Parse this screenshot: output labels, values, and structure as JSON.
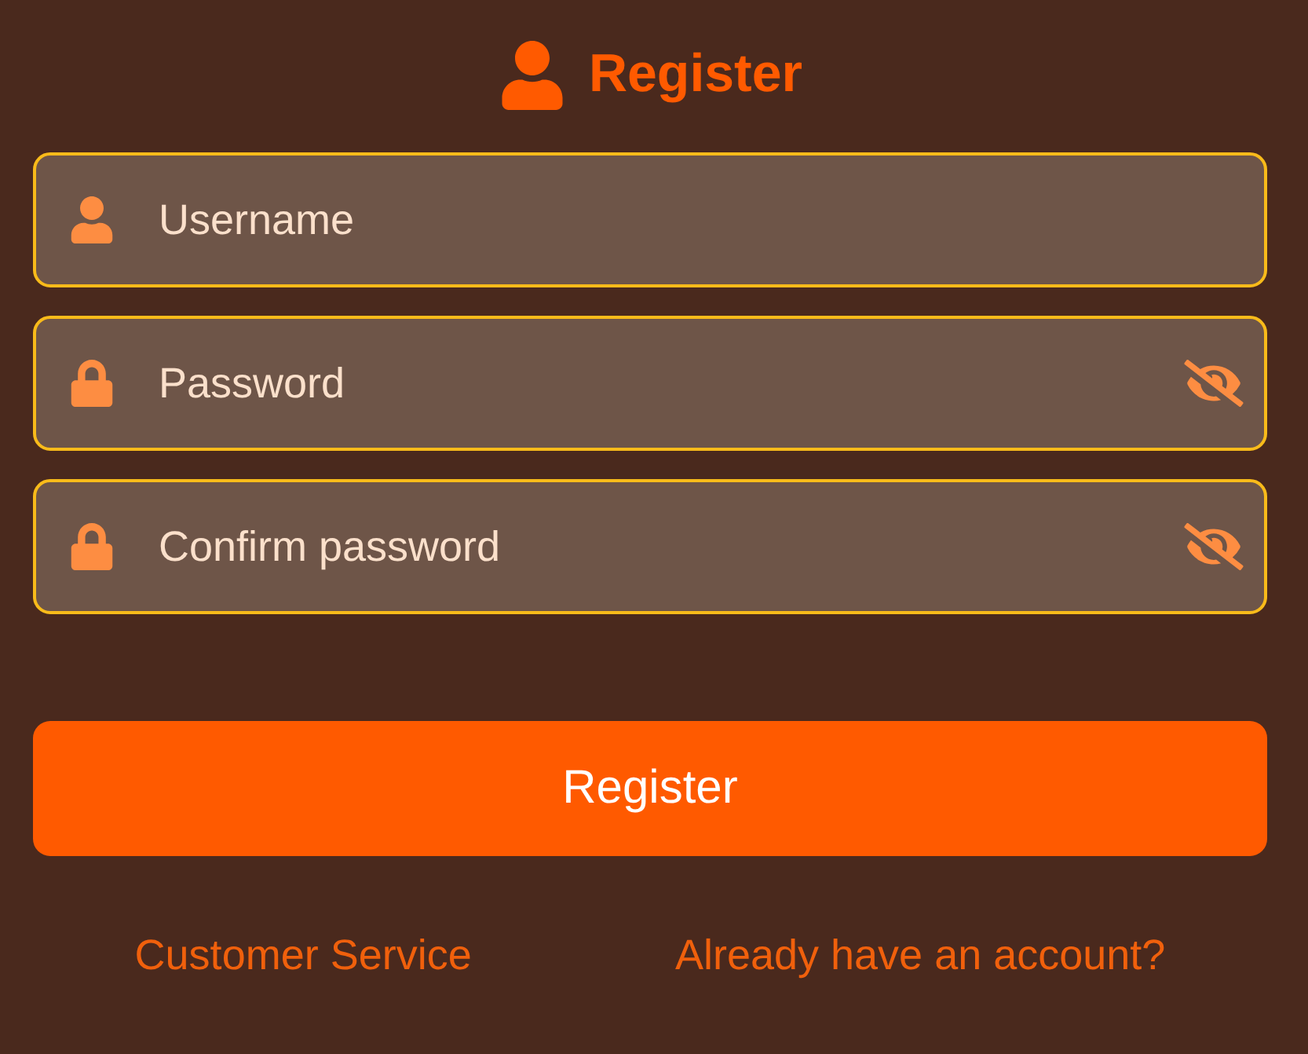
{
  "title": {
    "text": "Register"
  },
  "fields": [
    {
      "kind": "username",
      "placeholder": "Username"
    },
    {
      "kind": "password",
      "placeholder": "Password",
      "visible": false
    },
    {
      "kind": "password",
      "placeholder": "Confirm password",
      "visible": false
    }
  ],
  "submit": {
    "label": "Register"
  },
  "links": [
    {
      "label": "Customer Service"
    },
    {
      "label": "Already have an account?"
    }
  ]
}
